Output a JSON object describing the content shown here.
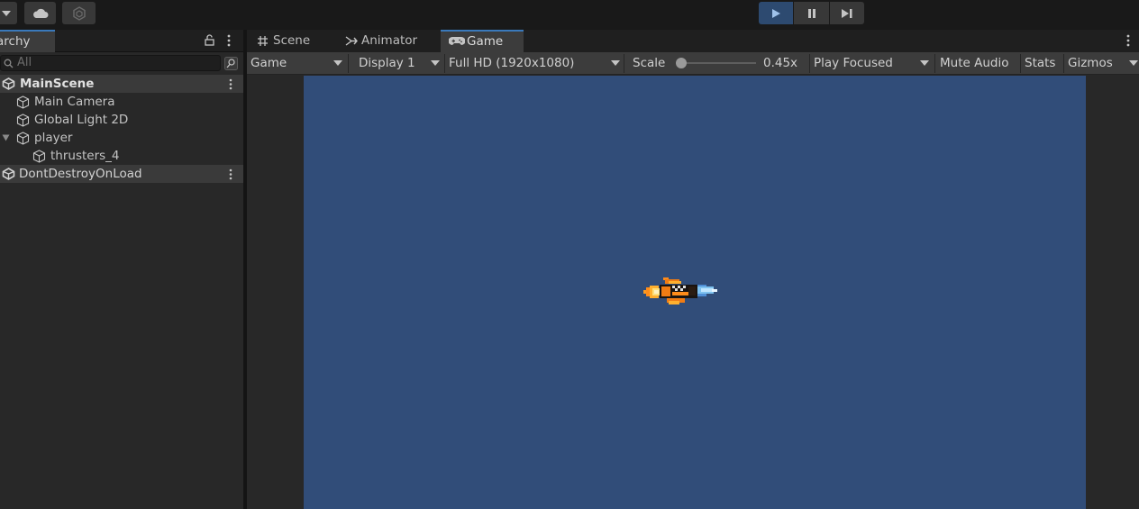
{
  "toolbar": {
    "play_icon": "play-icon",
    "pause_icon": "pause-icon",
    "step_icon": "step-icon",
    "colors": {
      "play_active": "#2d4a70"
    }
  },
  "hierarchy": {
    "tab_label": "archy",
    "search_placeholder": "All",
    "scenes": [
      {
        "name": "MainScene",
        "children": [
          {
            "name": "Main Camera"
          },
          {
            "name": "Global Light 2D"
          },
          {
            "name": "player",
            "expanded": true,
            "children": [
              {
                "name": "thrusters_4"
              }
            ]
          }
        ]
      },
      {
        "name": "DontDestroyOnLoad",
        "children": []
      }
    ]
  },
  "main": {
    "tabs": [
      {
        "label": "Scene",
        "icon": "grid-icon"
      },
      {
        "label": "Animator",
        "icon": "animator-icon"
      },
      {
        "label": "Game",
        "icon": "gamepad-icon",
        "active": true
      }
    ],
    "game_toolbar": {
      "view_mode": "Game",
      "display": "Display 1",
      "resolution": "Full HD (1920x1080)",
      "scale_label": "Scale",
      "scale_value": "0.45x",
      "play_mode": "Play Focused",
      "mute": "Mute Audio",
      "stats": "Stats",
      "gizmos": "Gizmos"
    },
    "canvas_color": "#314d79"
  }
}
